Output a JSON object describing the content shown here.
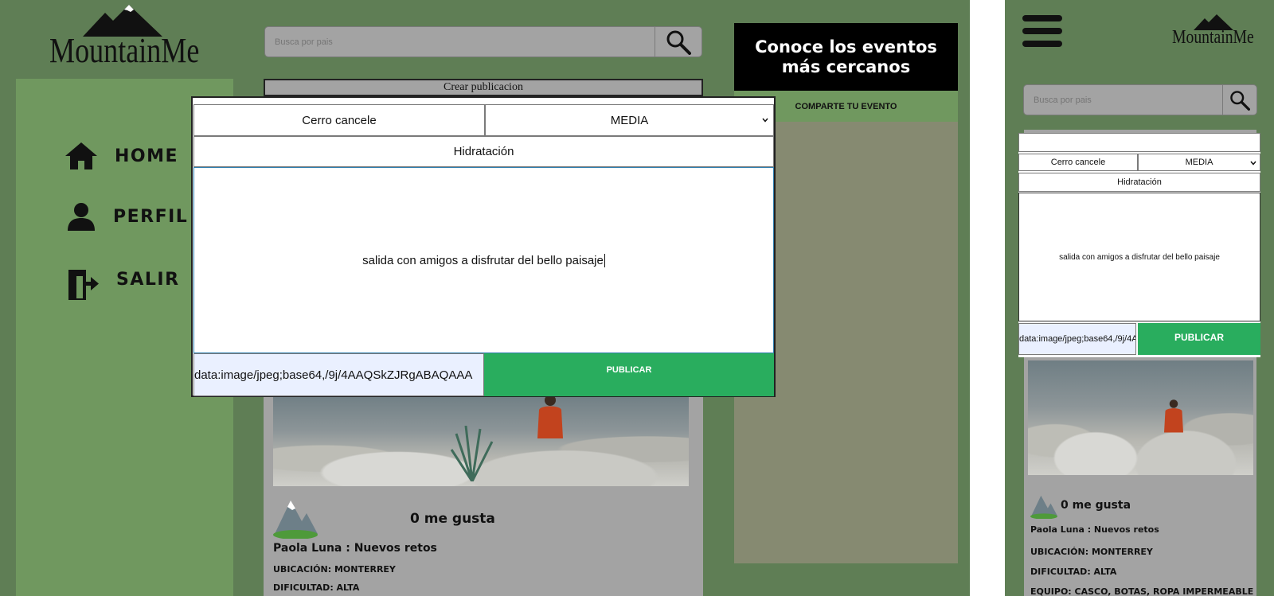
{
  "brand": {
    "name": "MountainMe"
  },
  "search": {
    "placeholder": "Busca por pais"
  },
  "nav": {
    "items": [
      {
        "label": "HOME",
        "icon": "home-icon"
      },
      {
        "label": "PERFIL",
        "icon": "user-icon"
      },
      {
        "label": "SALIR",
        "icon": "logout-icon"
      }
    ]
  },
  "feed": {
    "create_label": "Crear publicacion"
  },
  "events": {
    "heading": "Conoce los eventos más cercanos",
    "share_button": "COMPARTE TU EVENTO"
  },
  "modal": {
    "place_value": "Cerro cancele",
    "difficulty_value": "MEDIA",
    "tip_value": "Hidratación",
    "description_value": "salida con amigos a disfrutar del bello paisaje",
    "file_value": "data:image/jpeg;base64,/9j/4AAQSkZJRgABAQAAA",
    "file_value_mobile": "data:image/jpeg;base64,/9j/4A",
    "publish_label": "PUBLICAR"
  },
  "post": {
    "likes": "0 me gusta",
    "author_title": "Paola Luna : Nuevos retos",
    "location": "UBICACIÓN: MONTERREY",
    "difficulty": "DIFICULTAD: ALTA",
    "equipment": "EQUIPO: CASCO, BOTAS, ROPA IMPERMEABLE"
  },
  "colors": {
    "page_bg": "#5f7e55",
    "sidebar_bg": "#70985f",
    "publish_green": "#29ad5e",
    "events_header": "#000000"
  }
}
